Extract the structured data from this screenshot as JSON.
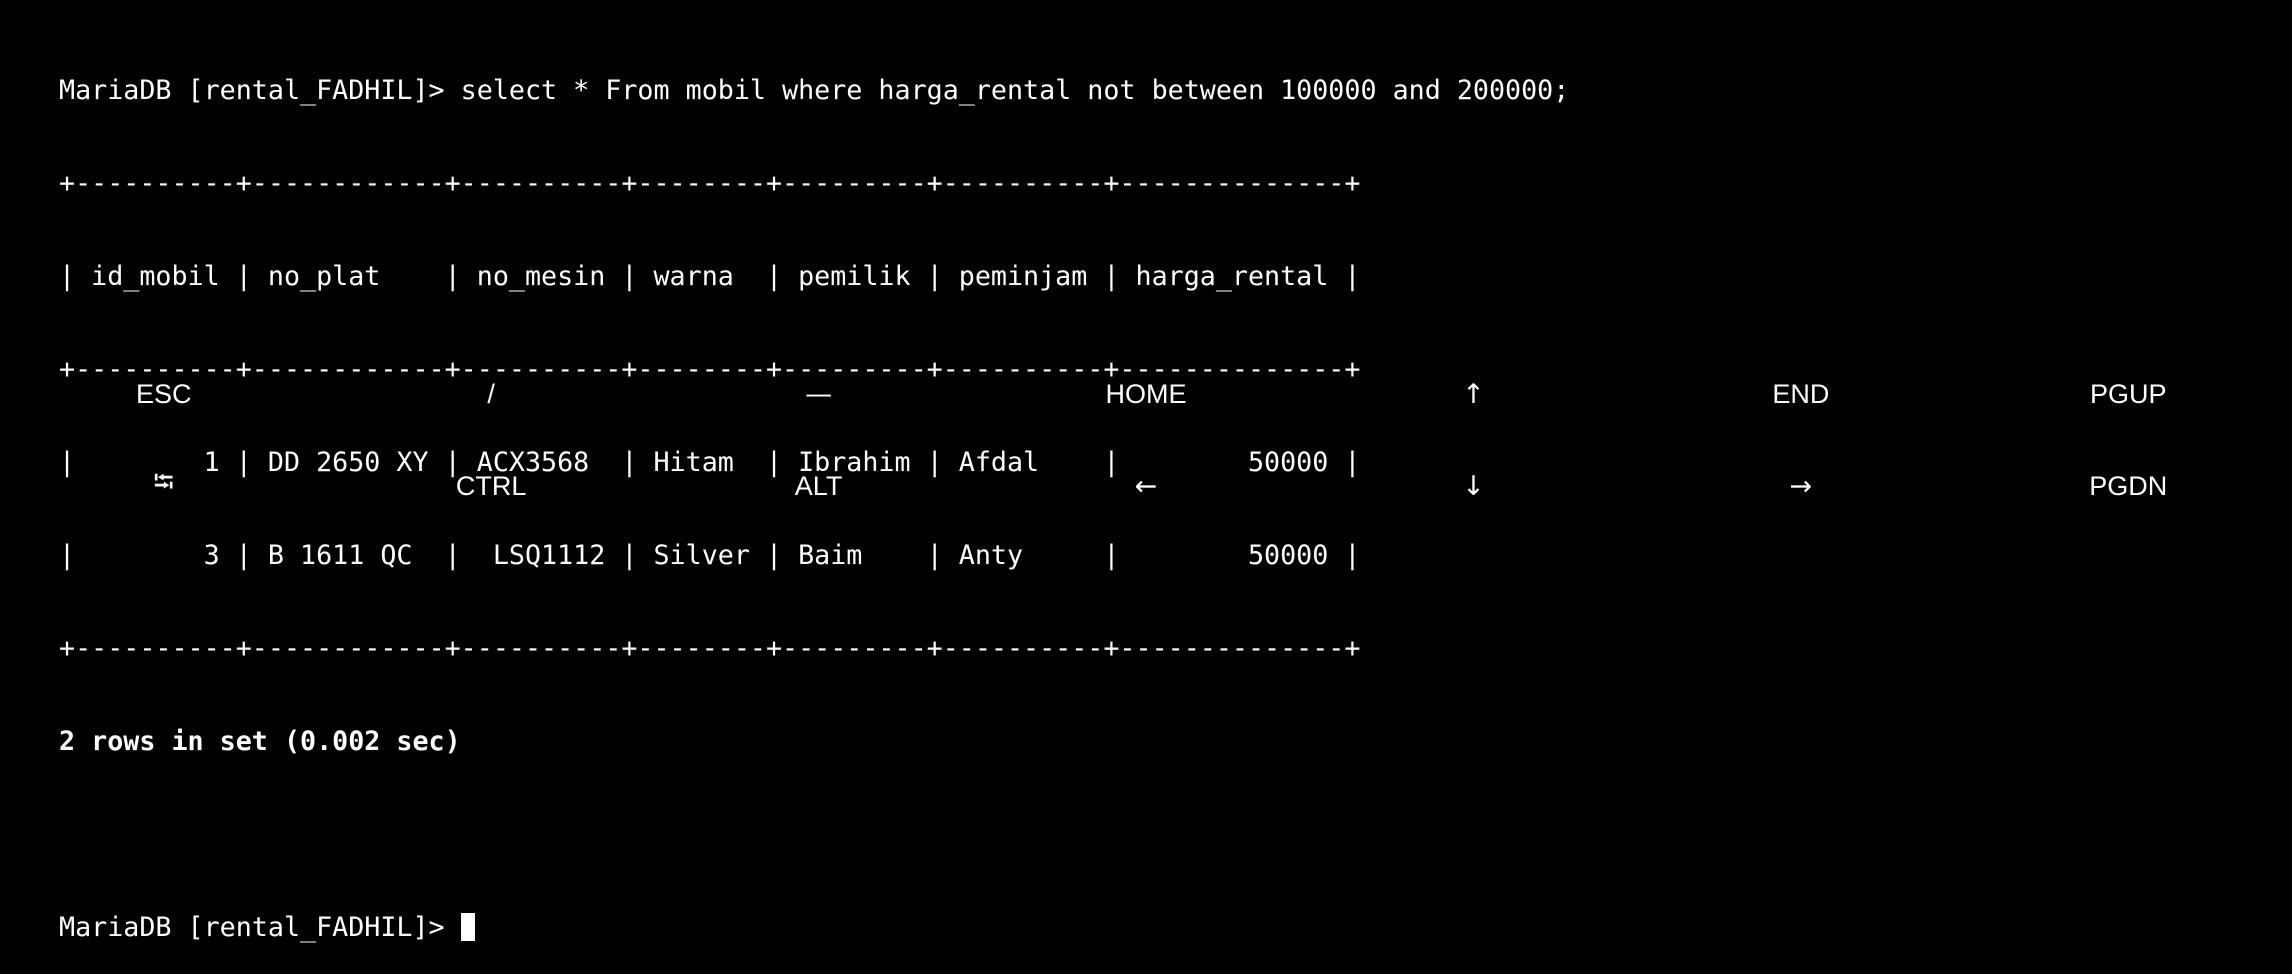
{
  "terminal": {
    "command_line": "MariaDB [rental_FADHIL]> select * From mobil where harga_rental not between 100000 and 200000;",
    "table_border": "+----------+------------+----------+--------+---------+----------+--------------+",
    "table_header": "| id_mobil | no_plat    | no_mesin | warna  | pemilik | peminjam | harga_rental |",
    "columns": [
      "id_mobil",
      "no_plat",
      "no_mesin",
      "warna",
      "pemilik",
      "peminjam",
      "harga_rental"
    ],
    "rows": [
      {
        "id_mobil": "1",
        "no_plat": "DD 2650 XY",
        "no_mesin": "ACX3568",
        "warna": "Hitam",
        "pemilik": "Ibrahim",
        "peminjam": "Afdal",
        "harga_rental": "50000",
        "text": "|        1 | DD 2650 XY | ACX3568  | Hitam  | Ibrahim | Afdal    |        50000 |"
      },
      {
        "id_mobil": "3",
        "no_plat": "B 1611 QC",
        "no_mesin": "LSQ1112",
        "warna": "Silver",
        "pemilik": "Baim",
        "peminjam": "Anty",
        "harga_rental": "50000",
        "text": "|        3 | B 1611 QC  |  LSQ1112 | Silver | Baim    | Anty     |        50000 |"
      }
    ],
    "result_summary": "2 rows in set (0.002 sec)",
    "prompt": "MariaDB [rental_FADHIL]> "
  },
  "extra_keys": {
    "row1": [
      {
        "label": "ESC",
        "icon": "esc-key"
      },
      {
        "label": "/",
        "icon": "slash-key"
      },
      {
        "label": "—",
        "icon": "dash-key"
      },
      {
        "label": "HOME",
        "icon": "home-key"
      },
      {
        "label": "↑",
        "icon": "arrow-up-icon"
      },
      {
        "label": "END",
        "icon": "end-key"
      },
      {
        "label": "PGUP",
        "icon": "page-up-key"
      }
    ],
    "row2": [
      {
        "label": "⭾",
        "icon": "tab-icon"
      },
      {
        "label": "CTRL",
        "icon": "ctrl-key"
      },
      {
        "label": "ALT",
        "icon": "alt-key"
      },
      {
        "label": "←",
        "icon": "arrow-left-icon"
      },
      {
        "label": "↓",
        "icon": "arrow-down-icon"
      },
      {
        "label": "→",
        "icon": "arrow-right-icon"
      },
      {
        "label": "PGDN",
        "icon": "page-down-key"
      }
    ]
  },
  "colors": {
    "background": "#000000",
    "foreground": "#ffffff"
  }
}
